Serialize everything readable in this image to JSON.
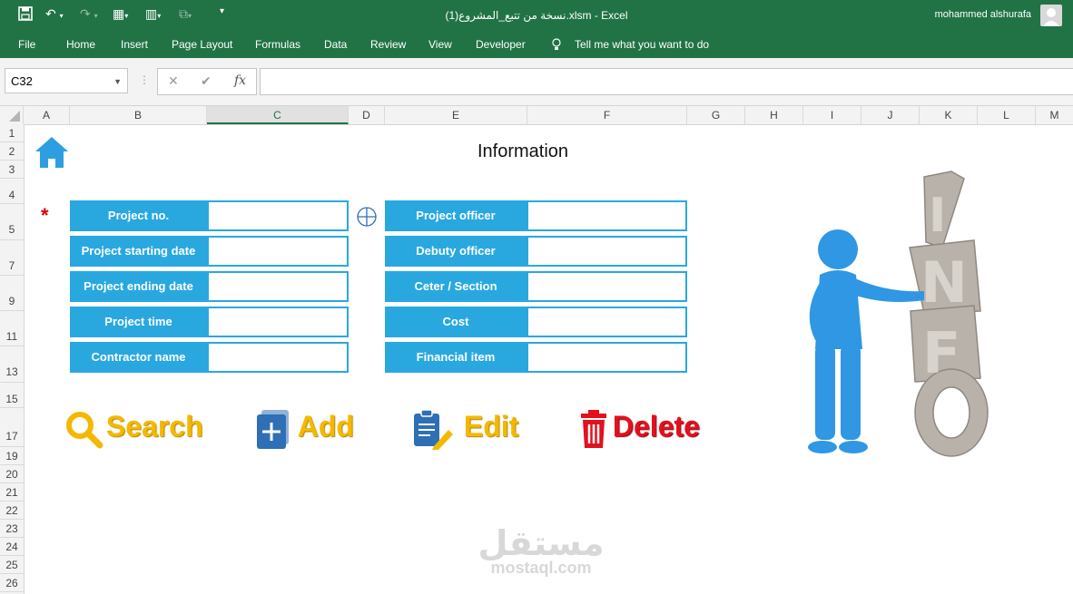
{
  "titlebar": {
    "filename": "نسخة من تتبع_المشروع(1).xlsm",
    "app": "Excel",
    "user": "mohammed alshurafa"
  },
  "menu": [
    "File",
    "Home",
    "Insert",
    "Page Layout",
    "Formulas",
    "Data",
    "Review",
    "View",
    "Developer",
    "Tell me what you want to do"
  ],
  "namebox": "C32",
  "columns": [
    "A",
    "B",
    "C",
    "D",
    "E",
    "F",
    "G",
    "H",
    "I",
    "J",
    "K",
    "L",
    "M"
  ],
  "rows": [
    "1",
    "2",
    "3",
    "4",
    "5",
    "7",
    "9",
    "11",
    "13",
    "15",
    "17",
    "19",
    "20",
    "21",
    "22",
    "23",
    "24",
    "25",
    "26"
  ],
  "sheet": {
    "title": "Information",
    "left_fields": [
      "Project no.",
      "Project starting date",
      "Project ending date",
      "Project time",
      "Contractor name"
    ],
    "right_fields": [
      "Project officer",
      "Debuty officer",
      "Ceter / Section",
      "Cost",
      "Financial item"
    ],
    "buttons": {
      "search": "Search",
      "add": "Add",
      "edit": "Edit",
      "delete": "Delete"
    },
    "art_letters": "INFO",
    "watermark_ar": "مستقل",
    "watermark_en": "mostaql.com"
  },
  "colors": {
    "excel_green": "#217346",
    "field_blue": "#29a8e0",
    "button_gold": "#f5b800",
    "delete_red": "#e3101e",
    "home_blue": "#2d9fe0"
  }
}
